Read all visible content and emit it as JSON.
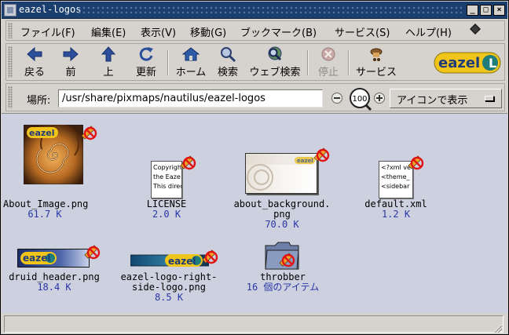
{
  "window": {
    "title": "eazel-logos",
    "buttons": [
      "_",
      "□",
      "×"
    ]
  },
  "menubar": {
    "items": [
      "ファイル(F)",
      "編集(E)",
      "表示(V)",
      "移動(G)",
      "ブックマーク(B)",
      "サービス(S)",
      "ヘルプ(H)"
    ]
  },
  "toolbar": {
    "back": "戻る",
    "forward": "前",
    "up": "上",
    "reload": "更新",
    "home": "ホーム",
    "search": "検索",
    "web_search": "ウェブ検索",
    "stop": "停止",
    "services": "サービス",
    "logo_text": "eazel"
  },
  "location": {
    "label": "場所:",
    "path": "/usr/share/pixmaps/nautilus/eazel-logos",
    "zoom": "100",
    "view_mode": "アイコンで表示"
  },
  "files": [
    {
      "name": "About_Image.png",
      "info": "61.7 K"
    },
    {
      "name": "LICENSE",
      "info": "2.0 K",
      "preview": [
        "Copyrigh",
        "the Eaze",
        "This direc"
      ]
    },
    {
      "name_line1": "about_background.",
      "name_line2": "png",
      "info": "70.0 K"
    },
    {
      "name": "default.xml",
      "info": "1.2 K",
      "preview": [
        "<?xml ve",
        "<theme_",
        "<sidebar"
      ]
    },
    {
      "name": "druid_header.png",
      "info": "18.4 K"
    },
    {
      "name_line1": "eazel-logo-right-",
      "name_line2": "side-logo.png",
      "info": "8.5 K"
    },
    {
      "name": "throbber",
      "info": "16 個のアイテム"
    }
  ],
  "colors": {
    "titlebar": "#1a3f6e",
    "content_bg": "#ccd0df",
    "info_text": "#2a36a8",
    "eazel_yellow": "#f0c419"
  }
}
